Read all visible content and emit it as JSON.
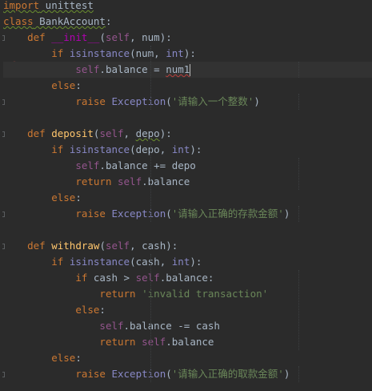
{
  "editor": {
    "language": "python",
    "theme_colors": {
      "background": "#2b2b2b",
      "keyword": "#cc7832",
      "self": "#94558d",
      "function_name": "#ffc66d",
      "magic_method": "#b200b2",
      "string": "#6a8759",
      "builtin": "#8888c6",
      "default_text": "#a9b7c6",
      "error_icon": "#d9534f"
    },
    "gutter_icon": "error-lightbulb-icon",
    "lines": [
      [
        {
          "t": "import",
          "c": "kw",
          "u": "typo"
        },
        {
          "t": " unittest",
          "c": "plain",
          "u": "typo"
        }
      ],
      [
        {
          "t": "class",
          "c": "kw",
          "u": "typo"
        },
        {
          "t": " BankAccount",
          "c": "plain",
          "u": "typo"
        },
        {
          "t": ":",
          "c": "punct"
        }
      ],
      [
        {
          "t": "    "
        },
        {
          "t": "def",
          "c": "kw"
        },
        {
          "t": " "
        },
        {
          "t": "__init__",
          "c": "magic"
        },
        {
          "t": "(",
          "c": "punct"
        },
        {
          "t": "self",
          "c": "self"
        },
        {
          "t": ", num):",
          "c": "plain"
        }
      ],
      [
        {
          "t": "        "
        },
        {
          "t": "if",
          "c": "kw"
        },
        {
          "t": " "
        },
        {
          "t": "isinstance",
          "c": "builtin"
        },
        {
          "t": "(num, ",
          "c": "plain"
        },
        {
          "t": "int",
          "c": "builtin"
        },
        {
          "t": "):",
          "c": "plain"
        }
      ],
      [
        {
          "t": "            "
        },
        {
          "t": "self",
          "c": "self"
        },
        {
          "t": ".balance = ",
          "c": "plain"
        },
        {
          "t": "num1",
          "c": "plain",
          "u": "err"
        }
      ],
      [
        {
          "t": "        "
        },
        {
          "t": "else",
          "c": "kw"
        },
        {
          "t": ":",
          "c": "punct"
        }
      ],
      [
        {
          "t": "            "
        },
        {
          "t": "raise",
          "c": "kw"
        },
        {
          "t": " "
        },
        {
          "t": "Exception",
          "c": "builtin"
        },
        {
          "t": "(",
          "c": "punct"
        },
        {
          "t": "'请输入一个整数'",
          "c": "str"
        },
        {
          "t": ")",
          "c": "punct"
        }
      ],
      [],
      [
        {
          "t": "    "
        },
        {
          "t": "def",
          "c": "kw"
        },
        {
          "t": " "
        },
        {
          "t": "deposit",
          "c": "fn"
        },
        {
          "t": "(",
          "c": "punct"
        },
        {
          "t": "self",
          "c": "self"
        },
        {
          "t": ", ",
          "c": "plain"
        },
        {
          "t": "depo",
          "c": "plain",
          "u": "typo"
        },
        {
          "t": "):",
          "c": "plain"
        }
      ],
      [
        {
          "t": "        "
        },
        {
          "t": "if",
          "c": "kw"
        },
        {
          "t": " "
        },
        {
          "t": "isinstance",
          "c": "builtin"
        },
        {
          "t": "(depo, ",
          "c": "plain"
        },
        {
          "t": "int",
          "c": "builtin"
        },
        {
          "t": "):",
          "c": "plain"
        }
      ],
      [
        {
          "t": "            "
        },
        {
          "t": "self",
          "c": "self"
        },
        {
          "t": ".balance += depo",
          "c": "plain"
        }
      ],
      [
        {
          "t": "            "
        },
        {
          "t": "return",
          "c": "kw"
        },
        {
          "t": " "
        },
        {
          "t": "self",
          "c": "self"
        },
        {
          "t": ".balance",
          "c": "plain"
        }
      ],
      [
        {
          "t": "        "
        },
        {
          "t": "else",
          "c": "kw"
        },
        {
          "t": ":",
          "c": "punct"
        }
      ],
      [
        {
          "t": "            "
        },
        {
          "t": "raise",
          "c": "kw"
        },
        {
          "t": " "
        },
        {
          "t": "Exception",
          "c": "builtin"
        },
        {
          "t": "(",
          "c": "punct"
        },
        {
          "t": "'请输入正确的存款金额'",
          "c": "str"
        },
        {
          "t": ")",
          "c": "punct"
        }
      ],
      [],
      [
        {
          "t": "    "
        },
        {
          "t": "def",
          "c": "kw"
        },
        {
          "t": " "
        },
        {
          "t": "withdraw",
          "c": "fn"
        },
        {
          "t": "(",
          "c": "punct"
        },
        {
          "t": "self",
          "c": "self"
        },
        {
          "t": ", cash):",
          "c": "plain"
        }
      ],
      [
        {
          "t": "        "
        },
        {
          "t": "if",
          "c": "kw"
        },
        {
          "t": " "
        },
        {
          "t": "isinstance",
          "c": "builtin"
        },
        {
          "t": "(cash, ",
          "c": "plain"
        },
        {
          "t": "int",
          "c": "builtin"
        },
        {
          "t": "):",
          "c": "plain"
        }
      ],
      [
        {
          "t": "            "
        },
        {
          "t": "if",
          "c": "kw"
        },
        {
          "t": " cash > ",
          "c": "plain"
        },
        {
          "t": "self",
          "c": "self"
        },
        {
          "t": ".balance:",
          "c": "plain"
        }
      ],
      [
        {
          "t": "                "
        },
        {
          "t": "return",
          "c": "kw"
        },
        {
          "t": " "
        },
        {
          "t": "'invalid transaction'",
          "c": "str"
        }
      ],
      [
        {
          "t": "            "
        },
        {
          "t": "else",
          "c": "kw"
        },
        {
          "t": ":",
          "c": "punct"
        }
      ],
      [
        {
          "t": "                "
        },
        {
          "t": "self",
          "c": "self"
        },
        {
          "t": ".balance -= cash",
          "c": "plain"
        }
      ],
      [
        {
          "t": "                "
        },
        {
          "t": "return",
          "c": "kw"
        },
        {
          "t": " "
        },
        {
          "t": "self",
          "c": "self"
        },
        {
          "t": ".balance",
          "c": "plain"
        }
      ],
      [
        {
          "t": "        "
        },
        {
          "t": "else",
          "c": "kw"
        },
        {
          "t": ":",
          "c": "punct"
        }
      ],
      [
        {
          "t": "            "
        },
        {
          "t": "raise",
          "c": "kw"
        },
        {
          "t": " "
        },
        {
          "t": "Exception",
          "c": "builtin"
        },
        {
          "t": "(",
          "c": "punct"
        },
        {
          "t": "'请输入正确的取款金额'",
          "c": "str"
        },
        {
          "t": ")",
          "c": "punct"
        }
      ]
    ]
  }
}
